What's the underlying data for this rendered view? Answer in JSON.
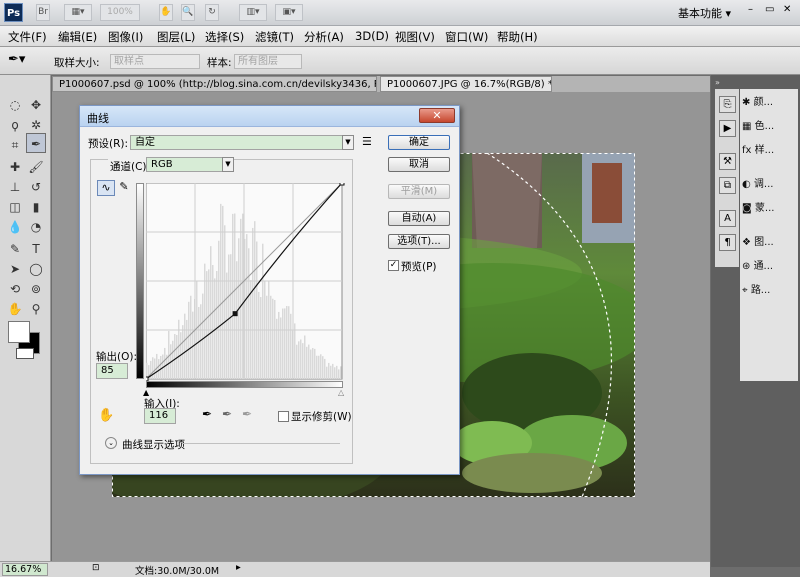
{
  "app": {
    "logo": "Ps",
    "zoom": "100%",
    "workspace": "基本功能",
    "window_controls": {
      "minimize": "–",
      "restore": "▭",
      "close": "✕"
    }
  },
  "menu": [
    {
      "label": "文件(F)"
    },
    {
      "label": "编辑(E)"
    },
    {
      "label": "图像(I)"
    },
    {
      "label": "图层(L)"
    },
    {
      "label": "选择(S)"
    },
    {
      "label": "滤镜(T)"
    },
    {
      "label": "分析(A)"
    },
    {
      "label": "3D(D)"
    },
    {
      "label": "视图(V)"
    },
    {
      "label": "窗口(W)"
    },
    {
      "label": "帮助(H)"
    }
  ],
  "options": {
    "sample_size_label": "取样大小:",
    "sample_size_value": "取样点",
    "sample_label": "样本:",
    "sample_value": "所有图层"
  },
  "tabs": [
    {
      "label": "P1000607.psd @ 100% (http://blog.sina.com.cn/devilsky3436, RGB/8)",
      "close": "×"
    },
    {
      "label": "P1000607.JPG @ 16.7%(RGB/8) *",
      "close": "×"
    }
  ],
  "status": {
    "zoom": "16.67%",
    "doc": "文档:30.0M/30.0M"
  },
  "panels": [
    {
      "label": "颜..."
    },
    {
      "label": "色..."
    },
    {
      "label": "样..."
    },
    {
      "label": "调..."
    },
    {
      "label": "蒙..."
    },
    {
      "label": "图..."
    },
    {
      "label": "通..."
    },
    {
      "label": "路..."
    }
  ],
  "dialog": {
    "title": "曲线",
    "preset_label": "预设(R):",
    "preset_value": "自定",
    "channel_label": "通道(C):",
    "channel_value": "RGB",
    "output_label": "输出(O):",
    "output_value": "85",
    "input_label": "输入(I):",
    "input_value": "116",
    "show_clipping_label": "显示修剪(W)",
    "show_clipping_checked": false,
    "curve_options_label": "曲线显示选项",
    "buttons": {
      "ok": "确定",
      "cancel": "取消",
      "smooth": "平滑(M)",
      "auto": "自动(A)",
      "options": "选项(T)..."
    },
    "preview_label": "预览(P)",
    "preview_checked": true
  },
  "curve_data": {
    "point": {
      "input": 116,
      "output": 85
    }
  }
}
